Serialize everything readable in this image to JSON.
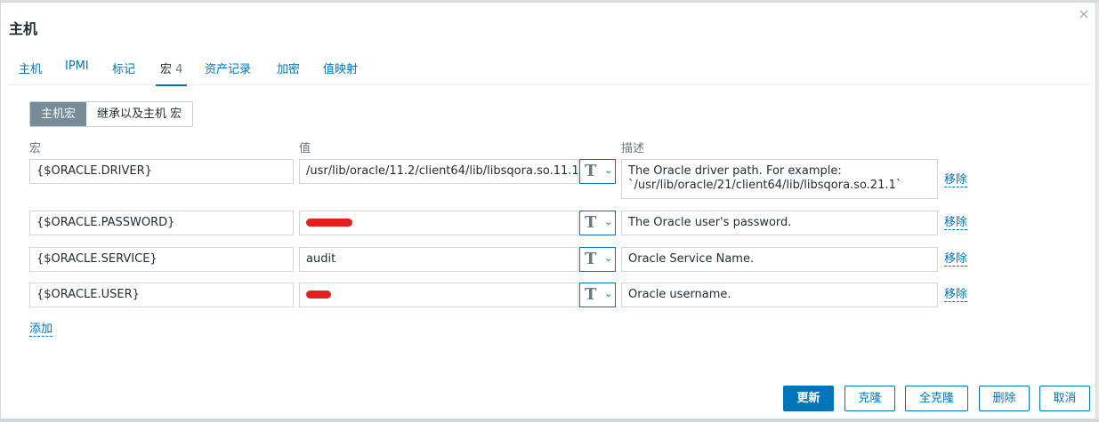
{
  "dialog": {
    "title": "主机",
    "close_glyph": "×"
  },
  "tabs": [
    {
      "label": "主机"
    },
    {
      "label": "IPMI"
    },
    {
      "label": "标记"
    },
    {
      "label": "宏",
      "count": "4",
      "active": true
    },
    {
      "label": "资产记录"
    },
    {
      "label": "加密"
    },
    {
      "label": "值映射"
    }
  ],
  "macro_mode": {
    "options": [
      "主机宏",
      "继承以及主机 宏"
    ],
    "selected": "主机宏"
  },
  "columns": {
    "macro": "宏",
    "value": "值",
    "description": "描述"
  },
  "macros": [
    {
      "macro": "{$ORACLE.DRIVER}",
      "value": "/usr/lib/oracle/11.2/client64/lib/libsqora.so.11.1",
      "description": "The Oracle driver path. For example: `/usr/lib/oracle/21/client64/lib/libsqora.so.21.1`",
      "redacted": false
    },
    {
      "macro": "{$ORACLE.PASSWORD}",
      "value": "",
      "description": "The Oracle user's password.",
      "redacted": true
    },
    {
      "macro": "{$ORACLE.SERVICE}",
      "value": "audit",
      "description": "Oracle Service Name.",
      "redacted": false
    },
    {
      "macro": "{$ORACLE.USER}",
      "value": "",
      "description": "Oracle username.",
      "redacted": true
    }
  ],
  "type_button": {
    "glyph": "T",
    "icon": "text-type-icon",
    "chevron": "⌄"
  },
  "row_action": "移除",
  "add_link": "添加",
  "footer": {
    "update": "更新",
    "clone": "克隆",
    "full_clone": "全克隆",
    "delete": "删除",
    "cancel": "取消"
  },
  "colors": {
    "accent": "#0275b8",
    "selected_segment": "#768d99",
    "redaction": "#e3201c"
  }
}
